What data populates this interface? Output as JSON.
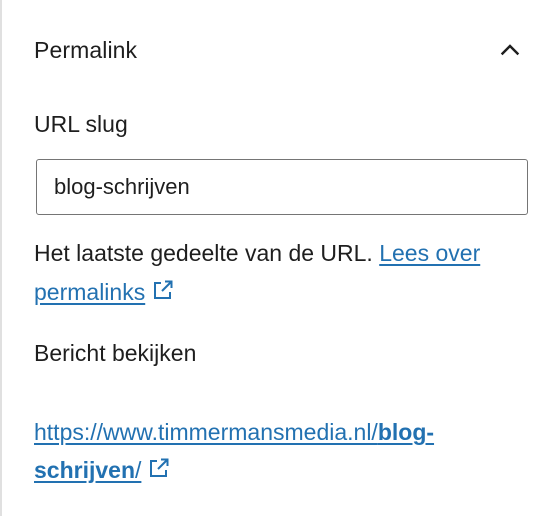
{
  "panel": {
    "title": "Permalink",
    "toggle_icon": "chevron-up-icon"
  },
  "slug": {
    "label": "URL slug",
    "value": "blog-schrijven"
  },
  "help": {
    "text": "Het laatste gedeelte van de URL. ",
    "link_text": "Lees over permalinks",
    "link_icon": "external-link-icon"
  },
  "view": {
    "label": "Bericht bekijken",
    "url_prefix": "https://www.timmermansmedia.nl/",
    "url_slug": "blog-schrijven",
    "url_suffix": "/",
    "link_icon": "external-link-icon"
  },
  "colors": {
    "link": "#2271b1",
    "text": "#1e1e1e",
    "input_border": "#757575"
  }
}
